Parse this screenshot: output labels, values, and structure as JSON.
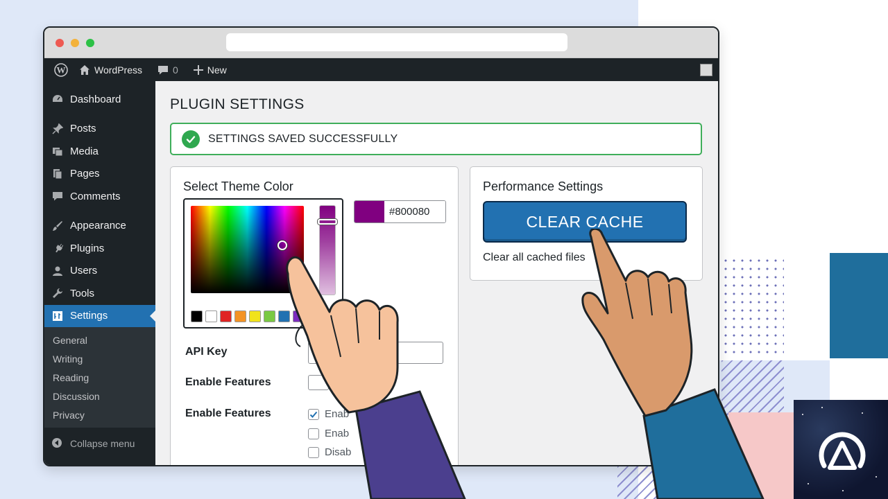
{
  "admin_bar": {
    "site_name": "WordPress",
    "comments_count": "0",
    "new_label": "New"
  },
  "sidebar": {
    "items": [
      {
        "label": "Dashboard",
        "icon": "dashboard-icon"
      },
      {
        "label": "Posts",
        "icon": "pin-icon"
      },
      {
        "label": "Media",
        "icon": "media-icon"
      },
      {
        "label": "Pages",
        "icon": "pages-icon"
      },
      {
        "label": "Comments",
        "icon": "comment-icon"
      },
      {
        "label": "Appearance",
        "icon": "brush-icon"
      },
      {
        "label": "Plugins",
        "icon": "plug-icon"
      },
      {
        "label": "Users",
        "icon": "user-icon"
      },
      {
        "label": "Tools",
        "icon": "wrench-icon"
      },
      {
        "label": "Settings",
        "icon": "settings-icon",
        "active": true
      }
    ],
    "submenu": [
      "General",
      "Writing",
      "Reading",
      "Discussion",
      "Privacy"
    ],
    "collapse_label": "Collapse menu"
  },
  "page": {
    "title": "PLUGIN SETTINGS",
    "notice": "SETTINGS SAVED SUCCESSFULLY"
  },
  "theme_color": {
    "title": "Select Theme Color",
    "hex_value": "#800080",
    "selected_color": "#800080",
    "swatches": [
      "#000000",
      "#ffffff",
      "#e02424",
      "#f39325",
      "#f1e31c",
      "#7ac943",
      "#2271b1",
      "#7b2cbf"
    ]
  },
  "form": {
    "api_key_label": "API Key",
    "enable_features_label_1": "Enable Features",
    "enable_features_label_2": "Enable Features",
    "checkboxes": [
      {
        "label": "Enab",
        "checked": true
      },
      {
        "label": "Enab",
        "checked": false
      },
      {
        "label": "Disab",
        "checked": false
      }
    ]
  },
  "performance": {
    "title": "Performance Settings",
    "button_label": "CLEAR CACHE",
    "description": "Clear all cached files"
  },
  "colors": {
    "wp_dark": "#1d2327",
    "wp_blue": "#2271b1",
    "success_green": "#2fa84f"
  }
}
